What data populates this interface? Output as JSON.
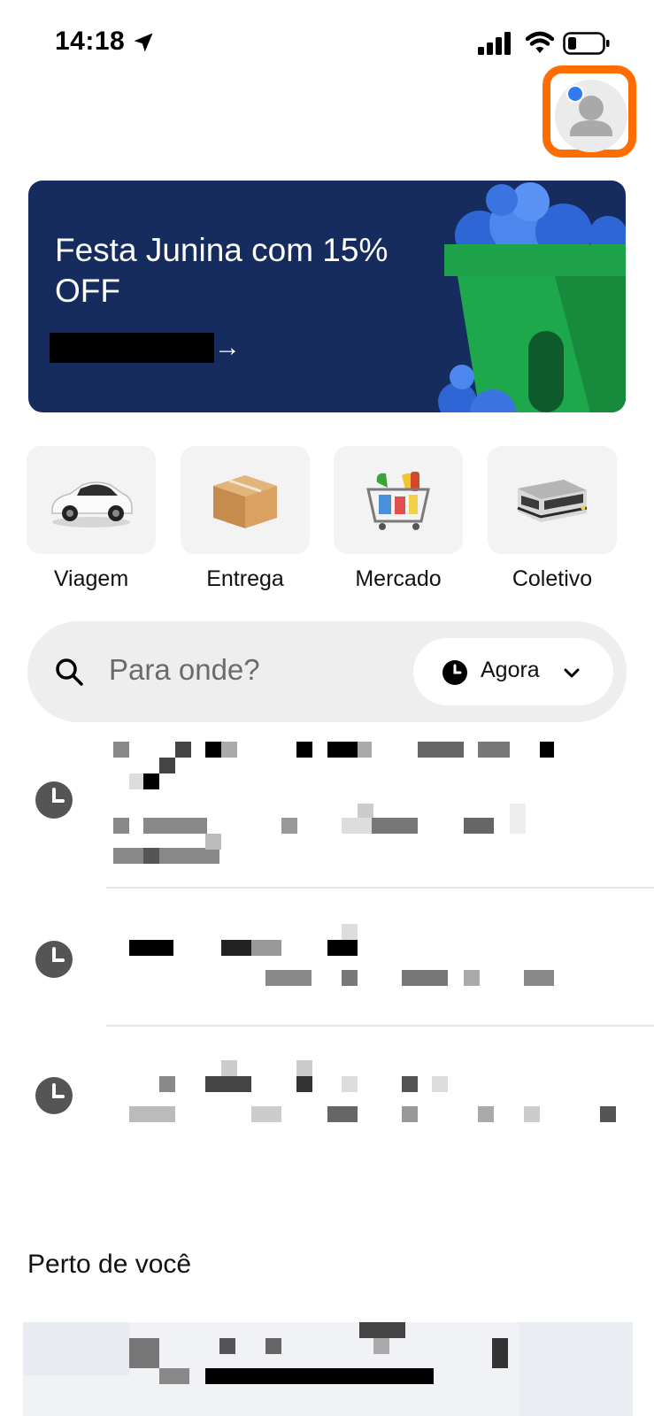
{
  "status_bar": {
    "time": "14:18",
    "icons": [
      "location-arrow-icon",
      "cellular-signal-icon",
      "wifi-icon",
      "battery-icon"
    ]
  },
  "profile": {
    "icon": "user-avatar-icon",
    "notification_dot_color": "#2f7bf2",
    "highlight_color": "#ff6d00"
  },
  "promo": {
    "title": "Festa Junina com 15% OFF",
    "cta_arrow": "→",
    "background": "#172c5e"
  },
  "shortcuts": [
    {
      "label": "Viagem",
      "icon": "car-icon"
    },
    {
      "label": "Entrega",
      "icon": "package-icon"
    },
    {
      "label": "Mercado",
      "icon": "grocery-basket-icon"
    },
    {
      "label": "Coletivo",
      "icon": "train-icon"
    }
  ],
  "search": {
    "placeholder": "Para onde?",
    "schedule_label": "Agora"
  },
  "recent_places": [
    {
      "icon": "clock-icon"
    },
    {
      "icon": "clock-icon"
    },
    {
      "icon": "clock-icon"
    }
  ],
  "nearby": {
    "title": "Perto de você"
  }
}
